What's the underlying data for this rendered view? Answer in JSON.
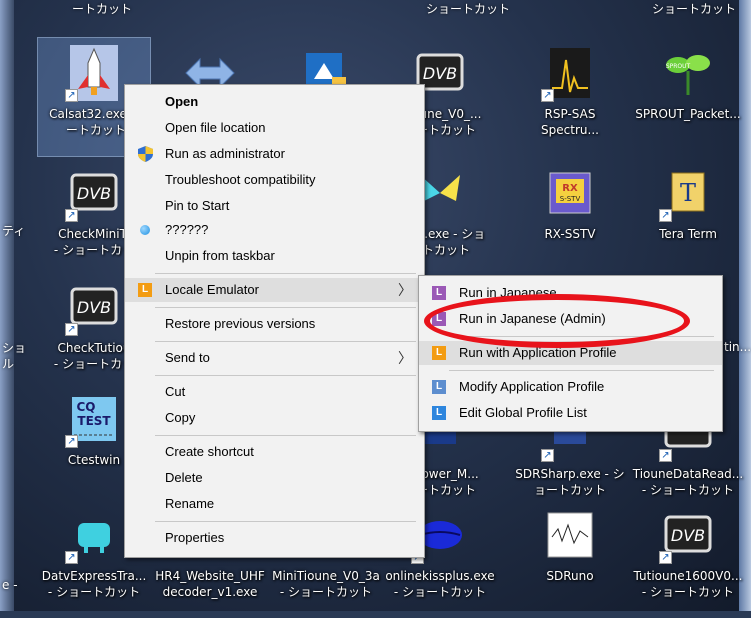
{
  "desktop": {
    "top_labels": [
      "ートカット",
      "ショートカット",
      "ショートカット"
    ],
    "icons": [
      {
        "id": "calsat",
        "label": "Calsat32.exe - \n ートカット",
        "icon": "rocket-icon"
      },
      {
        "id": "sdr",
        "label": "",
        "icon": "arrows-icon"
      },
      {
        "id": "blue",
        "label": "",
        "icon": "app-icon"
      },
      {
        "id": "minitioune1",
        "label": "iTioune_V0_...\nョートカット",
        "icon": "dvb-icon"
      },
      {
        "id": "rspsas",
        "label": "RSP-SAS\nSpectru...",
        "icon": "spectrum-icon"
      },
      {
        "id": "sprout",
        "label": "SPROUT_Packet...",
        "icon": "sprout-icon"
      },
      {
        "id": "checkmini",
        "label": "CheckMiniTi\n- ショートカッ",
        "icon": "dvb-icon"
      },
      {
        "id": "butterfly",
        "label": "V3_2.exe - ショ\nートカット",
        "icon": "butterfly-icon"
      },
      {
        "id": "rxsstv",
        "label": "RX-SSTV",
        "icon": "rx-sstv-icon"
      },
      {
        "id": "teraterm",
        "label": "Tera Term",
        "icon": "tera-term-icon"
      },
      {
        "id": "checktutiou",
        "label": "CheckTutiou\n- ショートカッ",
        "icon": "dvb-icon"
      },
      {
        "id": "ctestwin",
        "label": "Ctestwin",
        "icon": "cq-test-icon"
      },
      {
        "id": "powerm",
        "label": "e_Power_M...\nョートカット",
        "icon": "app-icon"
      },
      {
        "id": "sdrsharp",
        "label": "SDRSharp.exe - シ\nョートカット",
        "icon": "app-icon"
      },
      {
        "id": "tiounedata",
        "label": "TiouneDataRead...\n- ショートカット",
        "icon": "dvb-icon"
      },
      {
        "id": "datvexpress",
        "label": "DatvExpressTra...\n- ショートカット",
        "icon": "tv-icon"
      },
      {
        "id": "hr4",
        "label": "HR4_Website_UHF\ndecoder_v1.exe",
        "icon": "app-icon"
      },
      {
        "id": "minitioune2",
        "label": "MiniTioune_V0_3a\n- ショートカット",
        "icon": "app-icon"
      },
      {
        "id": "onlinekiss",
        "label": "onlinekissplus.exe\n- ショートカット",
        "icon": "lips-icon"
      },
      {
        "id": "sdruno",
        "label": "SDRuno",
        "icon": "sdruno-icon"
      },
      {
        "id": "tutioune1600",
        "label": "Tutioune1600V0...\n- ショートカット",
        "icon": "dvb-icon"
      }
    ],
    "edge_labels": [
      "ティ",
      "ショ\nル",
      "e -",
      "tin..."
    ],
    "partial_label": "tin..."
  },
  "context_menu": {
    "items": [
      {
        "label": "Open",
        "bold": true
      },
      {
        "label": "Open file location"
      },
      {
        "label": "Run as administrator",
        "icon": "shield-icon"
      },
      {
        "label": "Troubleshoot compatibility"
      },
      {
        "label": "Pin to Start"
      },
      {
        "label": "??????",
        "icon": "blue-dot-icon"
      },
      {
        "label": "Unpin from taskbar"
      },
      {
        "label": "Locale Emulator",
        "icon": "locale-emulator-icon",
        "submenu": true
      },
      {
        "label": "Restore previous versions"
      },
      {
        "label": "Send to",
        "submenu": true
      },
      {
        "label": "Cut"
      },
      {
        "label": "Copy"
      },
      {
        "label": "Create shortcut"
      },
      {
        "label": "Delete"
      },
      {
        "label": "Rename"
      },
      {
        "label": "Properties"
      }
    ],
    "locale_icon_letter": "L"
  },
  "submenu": {
    "items": [
      {
        "label": "Run in Japanese",
        "color": "#9b59b6"
      },
      {
        "label": "Run in Japanese (Admin)",
        "color": "#9b59b6"
      },
      {
        "label": "Run with Application Profile",
        "color": "#f39c12"
      },
      {
        "label": "Modify Application Profile",
        "color": "#5d8ecf"
      },
      {
        "label": "Edit Global Profile List",
        "color": "#2e86de"
      }
    ],
    "icon_letter": "L"
  },
  "annotation": {
    "color": "#e8131b",
    "shape": "ellipse"
  },
  "glyphs": {
    "shortcut_arrow": "↗",
    "submenu_arrow": "〉",
    "tera_letter": "T",
    "dvb": "DVB",
    "cq": "CQ",
    "test": "TEST",
    "rx": "RX",
    "sstv": "S-STV",
    "sprout": "SPROUT"
  }
}
